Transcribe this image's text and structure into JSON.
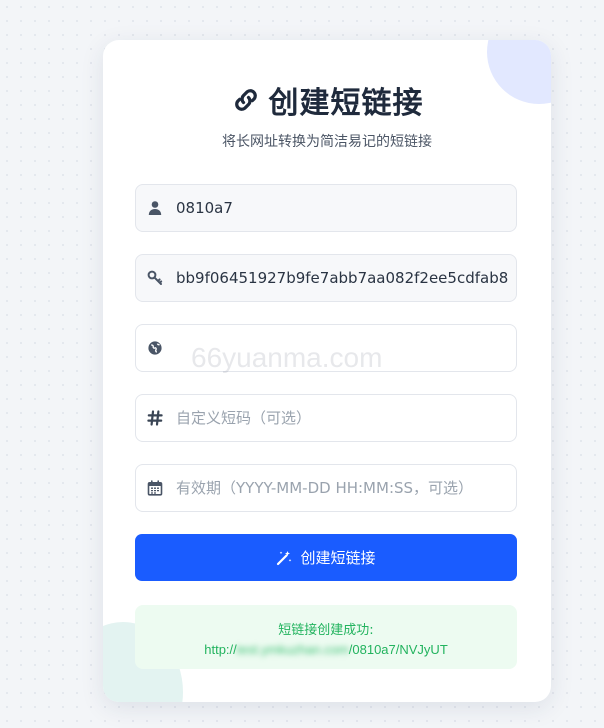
{
  "header": {
    "title": "创建短链接",
    "subtitle": "将长网址转换为简洁易记的短链接"
  },
  "form": {
    "username": {
      "icon": "user-icon",
      "value": "0810a7",
      "placeholder": ""
    },
    "api_key": {
      "icon": "key-icon",
      "value": "bb9f06451927b9fe7abb7aa082f2ee5cdfab8",
      "placeholder": ""
    },
    "url": {
      "icon": "globe-icon",
      "value": "",
      "placeholder": ""
    },
    "custom_code": {
      "icon": "hash-icon",
      "value": "",
      "placeholder": "自定义短码（可选）"
    },
    "expiry": {
      "icon": "calendar-icon",
      "value": "",
      "placeholder": "有效期（YYYY-MM-DD HH:MM:SS，可选）"
    }
  },
  "submit": {
    "icon": "magic-wand-icon",
    "label": "创建短链接"
  },
  "watermark": "66yuanma.com",
  "result": {
    "label": "短链接创建成功:",
    "link_prefix": "http://",
    "link_blurred": "test.ymkuzhan.com",
    "link_suffix": "/0810a7/NVJyUT"
  },
  "colors": {
    "primary": "#1a5cff",
    "success": "#22b35e",
    "success_bg": "#edfbf1",
    "title": "#1f2a3c"
  }
}
